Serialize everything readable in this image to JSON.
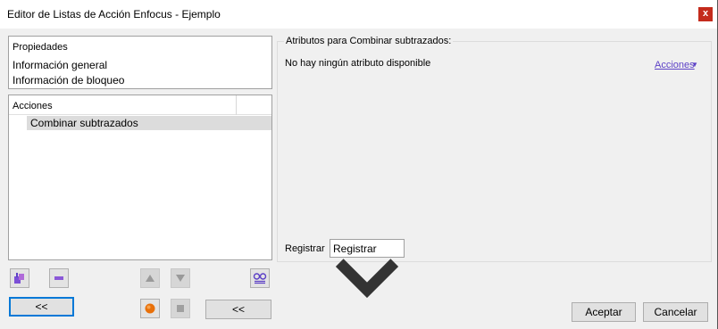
{
  "window": {
    "title": "Editor de Listas de Acción Enfocus - Ejemplo",
    "close_label": "x"
  },
  "properties": {
    "header": "Propiedades",
    "items": [
      "Información general",
      "Información de bloqueo"
    ]
  },
  "actions": {
    "header": "Acciones",
    "items": [
      "Combinar subtrazados"
    ]
  },
  "toolbar": {
    "left_collapse_label": "<<",
    "right_collapse_label": "<<"
  },
  "attributes": {
    "legend": "Atributos para Combinar subtrazados:",
    "empty_text": "No hay ningún atributo disponible",
    "menu_label": "Acciones"
  },
  "register": {
    "label": "Registrar",
    "selected": "Registrar"
  },
  "footer": {
    "accept_label": "Aceptar",
    "cancel_label": "Cancelar"
  },
  "colors": {
    "accent": "#0078d7",
    "close": "#c42b1c",
    "link": "#5b3fc6",
    "record": "#e8700a"
  }
}
